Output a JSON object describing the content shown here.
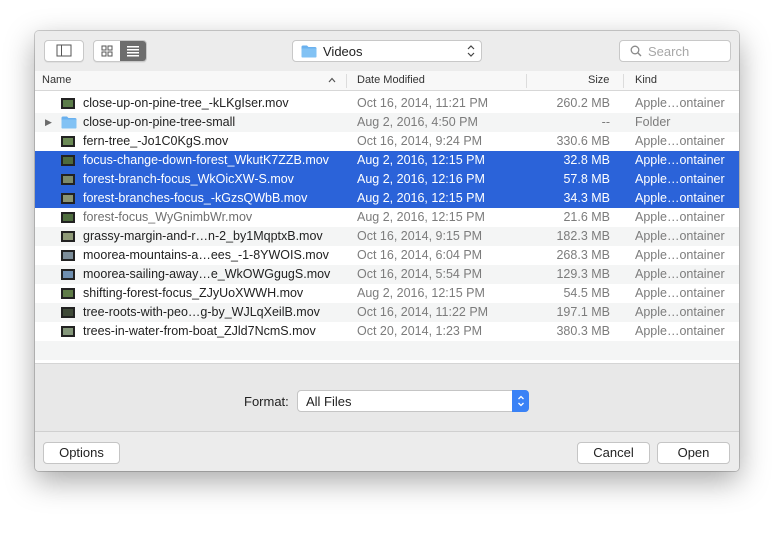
{
  "toolbar": {
    "location": "Videos",
    "search_placeholder": "Search"
  },
  "columns": {
    "name": "Name",
    "date": "Date Modified",
    "size": "Size",
    "kind": "Kind"
  },
  "rows": [
    {
      "name": "close-up-on-pine-tree_-kLKgIser.mov",
      "date": "Oct 16, 2014, 11:21 PM",
      "size": "260.2 MB",
      "kind": "Apple…ontainer"
    },
    {
      "name": "close-up-on-pine-tree-small",
      "date": "Aug 2, 2016, 4:50 PM",
      "size": "--",
      "kind": "Folder"
    },
    {
      "name": "fern-tree_-Jo1C0KgS.mov",
      "date": "Oct 16, 2014, 9:24 PM",
      "size": "330.6 MB",
      "kind": "Apple…ontainer"
    },
    {
      "name": "focus-change-down-forest_WkutK7ZZB.mov",
      "date": "Aug 2, 2016, 12:15 PM",
      "size": "32.8 MB",
      "kind": "Apple…ontainer"
    },
    {
      "name": "forest-branch-focus_WkOicXW-S.mov",
      "date": "Aug 2, 2016, 12:16 PM",
      "size": "57.8 MB",
      "kind": "Apple…ontainer"
    },
    {
      "name": "forest-branches-focus_-kGzsQWbB.mov",
      "date": "Aug 2, 2016, 12:15 PM",
      "size": "34.3 MB",
      "kind": "Apple…ontainer"
    },
    {
      "name": "forest-focus_WyGnimbWr.mov",
      "date": "Aug 2, 2016, 12:15 PM",
      "size": "21.6 MB",
      "kind": "Apple…ontainer"
    },
    {
      "name": "grassy-margin-and-r…n-2_by1MqptxB.mov",
      "date": "Oct 16, 2014, 9:15 PM",
      "size": "182.3 MB",
      "kind": "Apple…ontainer"
    },
    {
      "name": "moorea-mountains-a…ees_-1-8YWOIS.mov",
      "date": "Oct 16, 2014, 6:04 PM",
      "size": "268.3 MB",
      "kind": "Apple…ontainer"
    },
    {
      "name": "moorea-sailing-away…e_WkOWGgugS.mov",
      "date": "Oct 16, 2014, 5:54 PM",
      "size": "129.3 MB",
      "kind": "Apple…ontainer"
    },
    {
      "name": "shifting-forest-focus_ZJyUoXWWH.mov",
      "date": "Aug 2, 2016, 12:15 PM",
      "size": "54.5 MB",
      "kind": "Apple…ontainer"
    },
    {
      "name": "tree-roots-with-peo…g-by_WJLqXeilB.mov",
      "date": "Oct 16, 2014, 11:22 PM",
      "size": "197.1 MB",
      "kind": "Apple…ontainer"
    },
    {
      "name": "trees-in-water-from-boat_ZJld7NcmS.mov",
      "date": "Oct 20, 2014, 1:23 PM",
      "size": "380.3 MB",
      "kind": "Apple…ontainer"
    }
  ],
  "format": {
    "label": "Format:",
    "value": "All Files"
  },
  "buttons": {
    "options": "Options",
    "cancel": "Cancel",
    "open": "Open"
  },
  "colors": {
    "selection": "#2b63d9",
    "accent": "#3a82f6",
    "folder": "#6ab1ef"
  }
}
